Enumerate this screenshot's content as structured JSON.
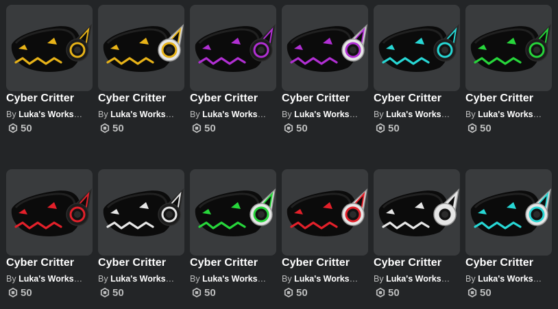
{
  "items": [
    {
      "name": "Cyber Critter",
      "by": "By",
      "creator": "Luka's Workshop",
      "price": "50",
      "accent": "#e8b318",
      "metal": "#1c1c1c"
    },
    {
      "name": "Cyber Critter",
      "by": "By",
      "creator": "Luka's Workshop",
      "price": "50",
      "accent": "#e8b318",
      "metal": "#e6e6e6"
    },
    {
      "name": "Cyber Critter",
      "by": "By",
      "creator": "Luka's Workshop",
      "price": "50",
      "accent": "#b12fd3",
      "metal": "#1c1c1c"
    },
    {
      "name": "Cyber Critter",
      "by": "By",
      "creator": "Luka's Workshop",
      "price": "50",
      "accent": "#b12fd3",
      "metal": "#e6e6e6"
    },
    {
      "name": "Cyber Critter",
      "by": "By",
      "creator": "Luka's Workshop",
      "price": "50",
      "accent": "#27d7d5",
      "metal": "#1c1c1c"
    },
    {
      "name": "Cyber Critter",
      "by": "By",
      "creator": "Luka's Workshop",
      "price": "50",
      "accent": "#27d63b",
      "metal": "#1c1c1c"
    },
    {
      "name": "Cyber Critter",
      "by": "By",
      "creator": "Luka's Workshop",
      "price": "50",
      "accent": "#e3202a",
      "metal": "#1c1c1c"
    },
    {
      "name": "Cyber Critter",
      "by": "By",
      "creator": "Luka's Workshop",
      "price": "50",
      "accent": "#e6e6e6",
      "metal": "#1c1c1c"
    },
    {
      "name": "Cyber Critter",
      "by": "By",
      "creator": "Luka's Workshop",
      "price": "50",
      "accent": "#27d63b",
      "metal": "#e6e6e6"
    },
    {
      "name": "Cyber Critter",
      "by": "By",
      "creator": "Luka's Workshop",
      "price": "50",
      "accent": "#e3202a",
      "metal": "#e6e6e6"
    },
    {
      "name": "Cyber Critter",
      "by": "By",
      "creator": "Luka's Workshop",
      "price": "50",
      "accent": "#e6e6e6",
      "metal": "#e6e6e6"
    },
    {
      "name": "Cyber Critter",
      "by": "By",
      "creator": "Luka's Workshop",
      "price": "50",
      "accent": "#27d7d5",
      "metal": "#e6e6e6"
    }
  ],
  "currency_icon": "robux-icon"
}
